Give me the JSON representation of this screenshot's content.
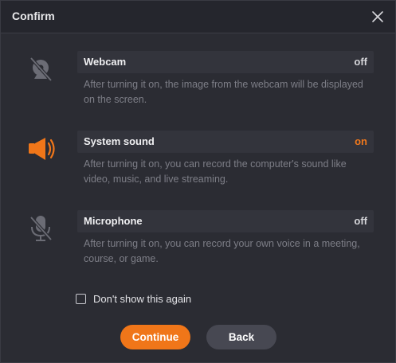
{
  "dialog": {
    "title": "Confirm"
  },
  "options": [
    {
      "label": "Webcam",
      "state": "off",
      "icon": "webcam-off-icon",
      "description": "After turning it on, the image from the webcam will be displayed on the screen."
    },
    {
      "label": "System sound",
      "state": "on",
      "icon": "speaker-on-icon",
      "description": "After turning it on, you can record the computer's sound like video, music, and live streaming."
    },
    {
      "label": "Microphone",
      "state": "off",
      "icon": "microphone-off-icon",
      "description": "After turning it on, you can record your own voice in a meeting, course, or game."
    }
  ],
  "dont_show_again": {
    "label": "Don't show this again",
    "checked": false
  },
  "buttons": {
    "continue_label": "Continue",
    "back_label": "Back"
  },
  "colors": {
    "accent": "#f07619",
    "background": "#2b2c33",
    "bar": "#33343c",
    "muted_text": "#7d7e87"
  }
}
